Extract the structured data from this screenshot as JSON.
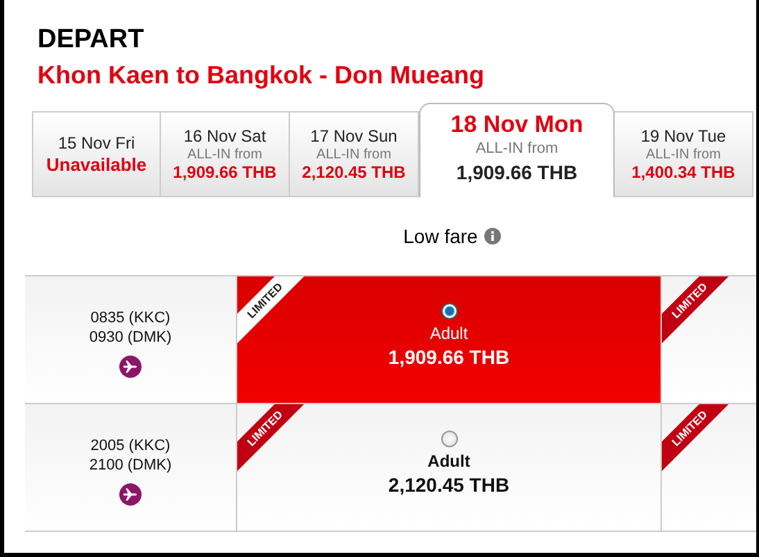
{
  "title": "DEPART",
  "route": "Khon Kaen  to  Bangkok - Don Mueang",
  "dates": [
    {
      "kind": "unavailable",
      "label": "15 Nov Fri",
      "status": "Unavailable",
      "selected": false
    },
    {
      "kind": "fare",
      "label": "16 Nov Sat",
      "note": "ALL-IN from",
      "price": "1,909.66 THB",
      "selected": false
    },
    {
      "kind": "fare",
      "label": "17 Nov Sun",
      "note": "ALL-IN from",
      "price": "2,120.45 THB",
      "selected": false
    },
    {
      "kind": "fare",
      "label": "18 Nov Mon",
      "note": "ALL-IN from",
      "price": "1,909.66 THB",
      "selected": true
    },
    {
      "kind": "fare",
      "label": "19 Nov Tue",
      "note": "ALL-IN from",
      "price": "1,400.34 THB",
      "selected": false
    }
  ],
  "fare_header": "Low fare",
  "flights": [
    {
      "depart": "0835  (KKC)",
      "arrive": "0930  (DMK)",
      "fare": {
        "ribbon": "LIMITED",
        "passenger": "Adult",
        "price": "1,909.66 THB",
        "selected": true
      },
      "next_ribbon": "LIMITED"
    },
    {
      "depart": "2005  (KKC)",
      "arrive": "2100  (DMK)",
      "fare": {
        "ribbon": "LIMITED",
        "passenger": "Adult",
        "price": "2,120.45 THB",
        "selected": false
      },
      "next_ribbon": "LIMITED"
    }
  ]
}
